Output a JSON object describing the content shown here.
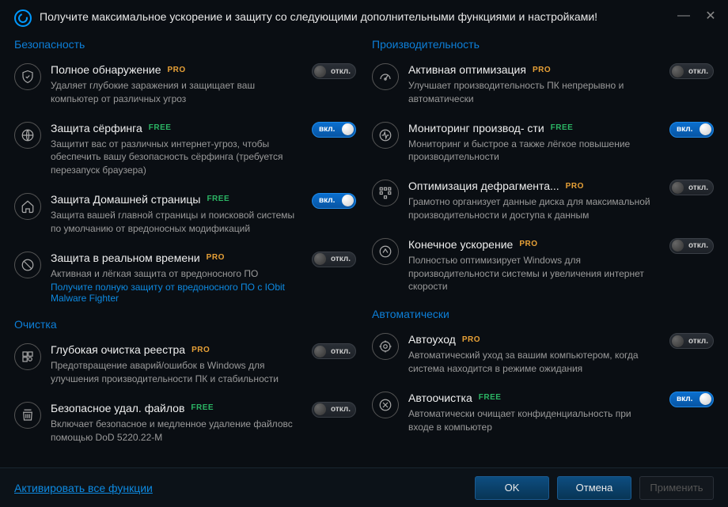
{
  "header": {
    "title": "Получите максимальное ускорение и защиту со следующими дополнительными функциями и настройками!"
  },
  "toggle_labels": {
    "on": "вкл.",
    "off": "откл."
  },
  "sections": {
    "security": {
      "title": "Безопасность",
      "items": [
        {
          "name": "full-detection",
          "icon": "shield-icon",
          "title": "Полное обнаружение",
          "badge": "PRO",
          "desc": "Удаляет глубокие заражения и защищает ваш компьютер от различных угроз",
          "state": "off"
        },
        {
          "name": "surfing-protect",
          "icon": "globe-icon",
          "title": "Защита сёрфинга",
          "badge": "FREE",
          "desc": "Защитит вас от различных интернет-угроз, чтобы обеспечить вашу безопасность сёрфинга (требуется перезапуск браузера)",
          "state": "on"
        },
        {
          "name": "homepage-protect",
          "icon": "home-icon",
          "title": "Защита Домашней страницы",
          "badge": "FREE",
          "desc": "Защита вашей главной страницы и поисковой системы по умолчанию от вредоносных модификаций",
          "state": "on"
        },
        {
          "name": "realtime-protect",
          "icon": "realtime-icon",
          "title": "Защита в реальном времени",
          "badge": "PRO",
          "desc": "Активная и лёгкая защита от вредоносного ПО",
          "link": "Получите полную защиту от вредоносного ПО с IObit Malware Fighter",
          "state": "off"
        }
      ]
    },
    "cleanup": {
      "title": "Очистка",
      "items": [
        {
          "name": "deep-registry-clean",
          "icon": "registry-icon",
          "title": "Глубокая очистка реестра",
          "badge": "PRO",
          "desc": "Предотвращение аварий/ошибок в Windows для улучшения производительности ПК и стабильности",
          "state": "off"
        },
        {
          "name": "secure-delete",
          "icon": "shred-icon",
          "title": "Безопасное удал. файлов",
          "badge": "FREE",
          "desc": "Включает безопасное и медленное удаление файловс помощью DoD 5220.22-M",
          "state": "off"
        }
      ]
    },
    "performance": {
      "title": "Производительность",
      "items": [
        {
          "name": "active-optimize",
          "icon": "gauge-icon",
          "title": "Активная оптимизация",
          "badge": "PRO",
          "desc": "Улучшает производительность ПК непрерывно и автоматически",
          "state": "off"
        },
        {
          "name": "perf-monitor",
          "icon": "pulse-icon",
          "title": "Мониторинг производ- сти",
          "badge": "FREE",
          "desc": "Мониторинг и быстрое а также лёгкое повышение производительности",
          "state": "on"
        },
        {
          "name": "defrag-optimize",
          "icon": "defrag-icon",
          "title": "Оптимизация дефрагмента...",
          "badge": "PRO",
          "desc": "Грамотно организует данные диска для максимальной производительности и доступа к данным",
          "state": "off"
        },
        {
          "name": "ultimate-speedup",
          "icon": "boost-icon",
          "title": "Конечное ускорение",
          "badge": "PRO",
          "desc": "Полностью оптимизирует Windows для производительности системы и увеличения интернет скорости",
          "state": "off"
        }
      ]
    },
    "automatic": {
      "title": "Автоматически",
      "items": [
        {
          "name": "auto-care",
          "icon": "autocare-icon",
          "title": "Автоуход",
          "badge": "PRO",
          "desc": "Автоматический уход за вашим компьютером, когда система находится в режиме ожидания",
          "state": "off"
        },
        {
          "name": "auto-clean",
          "icon": "autoclean-icon",
          "title": "Автоочистка",
          "badge": "FREE",
          "desc": "Автоматически очищает конфиденциальность при входе в компьютер",
          "state": "on"
        }
      ]
    }
  },
  "footer": {
    "activate": "Активировать все функции",
    "ok": "OK",
    "cancel": "Отмена",
    "apply": "Применить"
  }
}
